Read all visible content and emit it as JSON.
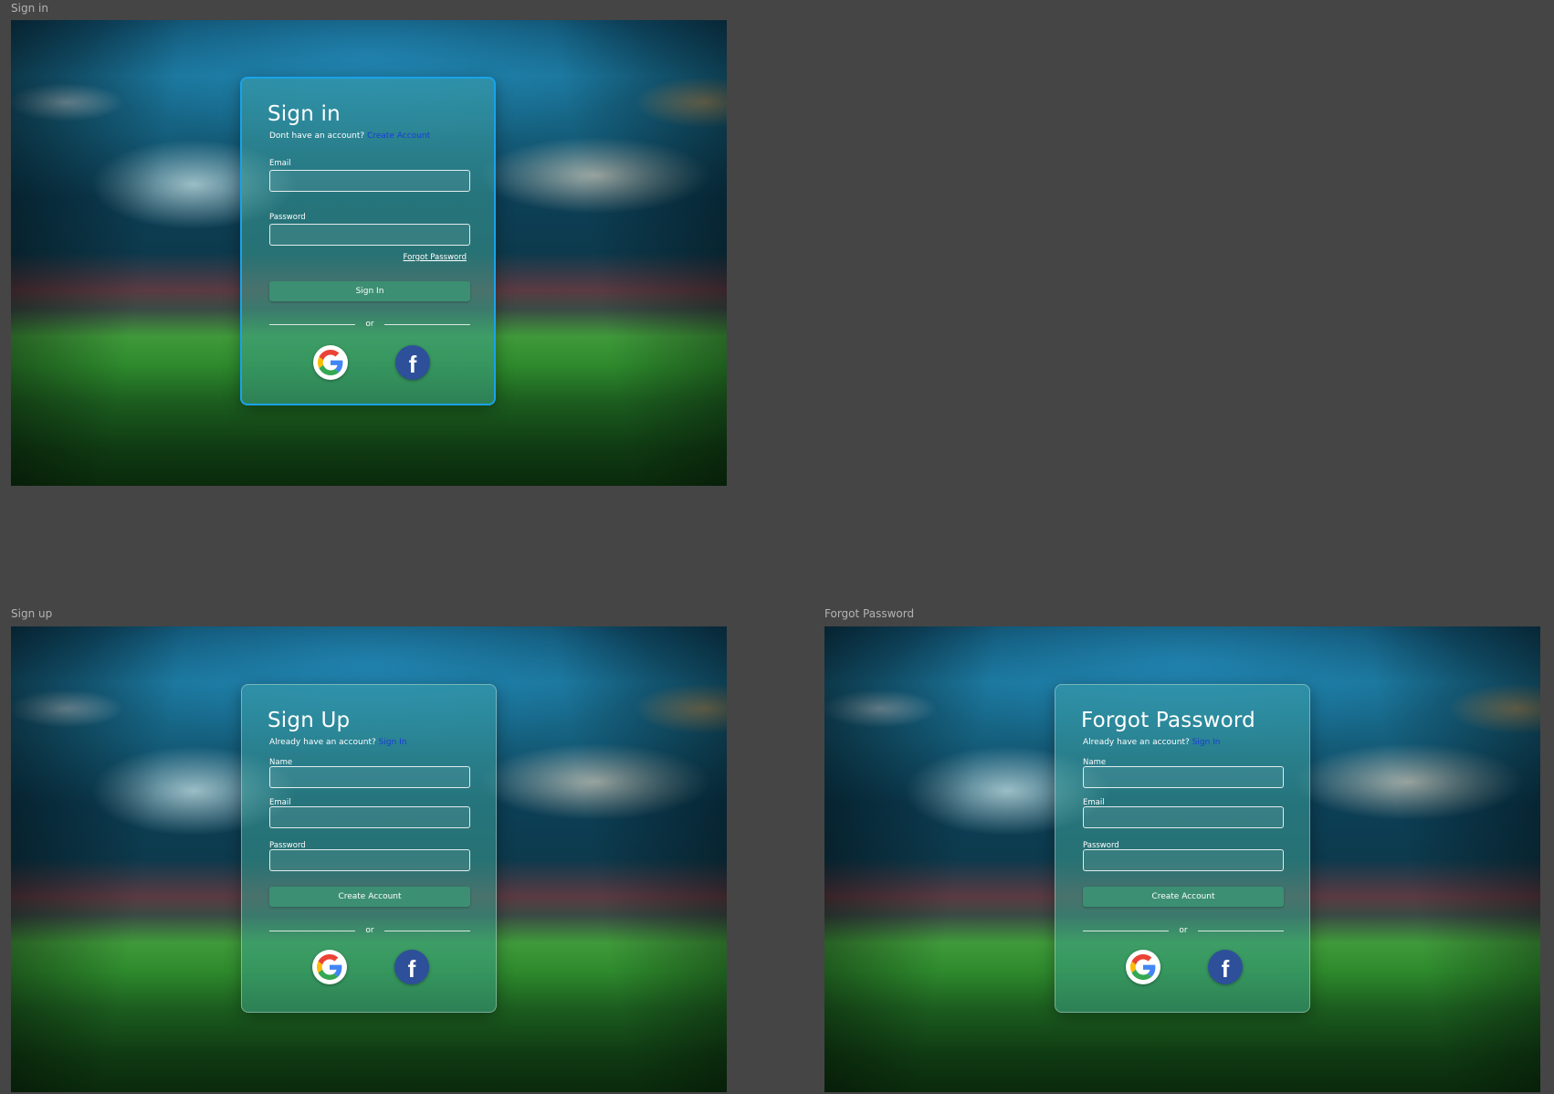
{
  "frames": {
    "signin": {
      "frame_label": "Sign in",
      "title": "Sign in",
      "subtitle_text": "Dont have an account?",
      "subtitle_link": "Create Account",
      "email_label": "Email",
      "password_label": "Password",
      "forgot_link": "Forgot Password",
      "submit_label": "Sign In",
      "divider_text": "or"
    },
    "signup": {
      "frame_label": "Sign up",
      "title": "Sign Up",
      "subtitle_text": "Already have an account?",
      "subtitle_link": "Sign In",
      "name_label": "Name",
      "email_label": "Email",
      "password_label": "Password",
      "submit_label": "Create Account",
      "divider_text": "or"
    },
    "forgot": {
      "frame_label": "Forgot Password",
      "title": "Forgot Password",
      "subtitle_text": "Already have an account?",
      "subtitle_link": "Sign In",
      "name_label": "Name",
      "email_label": "Email",
      "password_label": "Password",
      "submit_label": "Create Account",
      "divider_text": "or"
    }
  },
  "icons": {
    "google": "google-icon",
    "facebook": "facebook-icon"
  },
  "colors": {
    "canvas": "#454545",
    "link": "#1a3dd8",
    "button": "#3c8f72",
    "selected_border": "#19a2ea",
    "facebook": "#2e4f9a"
  }
}
